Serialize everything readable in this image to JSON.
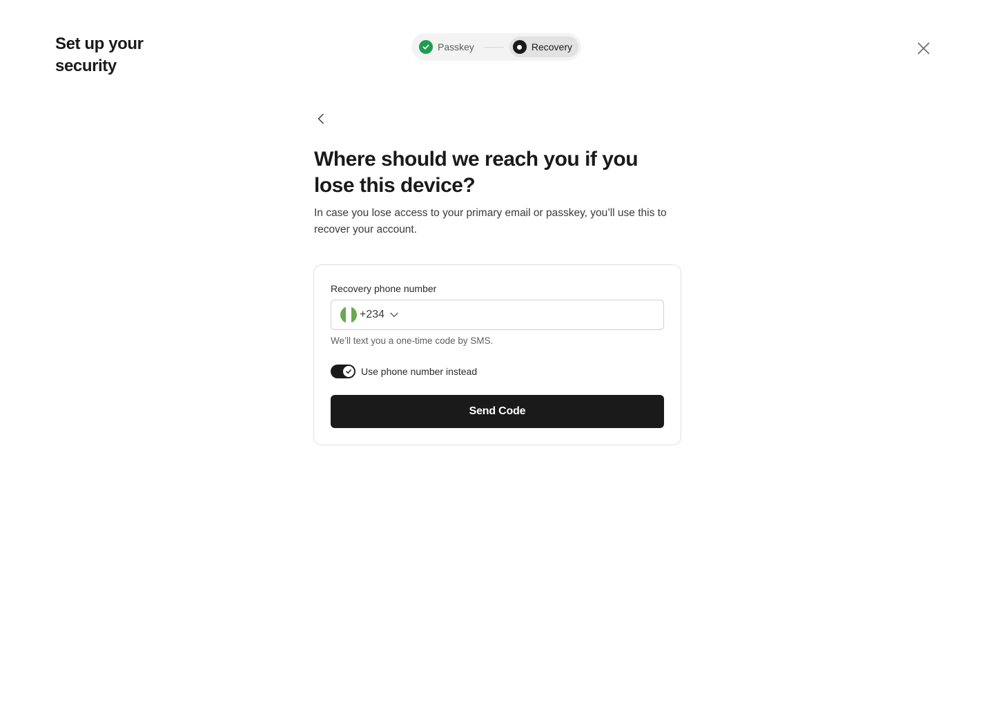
{
  "page": {
    "title": "Set up your security"
  },
  "stepper": {
    "steps": [
      {
        "label": "Passkey",
        "state": "complete",
        "icon": "check-circle-icon"
      },
      {
        "label": "Recovery",
        "state": "active",
        "icon": "active-step-icon"
      }
    ]
  },
  "header": {
    "close_icon": "close-icon",
    "back_icon": "chevron-left-icon"
  },
  "main": {
    "headline": "Where should we reach you if you lose this device?",
    "description": "In case you lose access to your primary email or passkey, you’ll use this to recover your account."
  },
  "form": {
    "phone_label": "Recovery phone number",
    "country_flag": "nigeria-flag-icon",
    "dial_code": "+234",
    "phone_value": "",
    "phone_placeholder": "",
    "helper_text": "We’ll text you a one-time code by SMS.",
    "toggle_label": "Use phone number instead",
    "toggle_on": true,
    "submit_label": "Send Code"
  },
  "colors": {
    "accent_dark": "#1a1a1a",
    "success_green": "#1f9d4f",
    "flag_green": "#6aa84f"
  }
}
